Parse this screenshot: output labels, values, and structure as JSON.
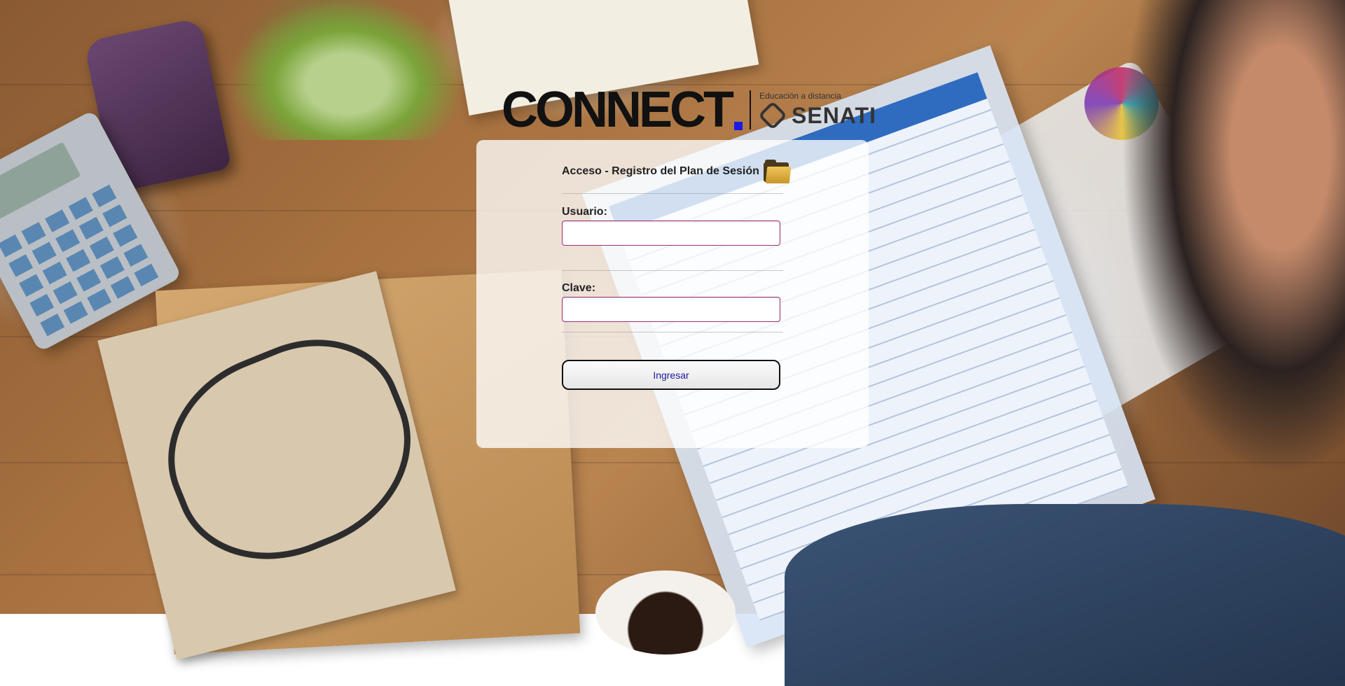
{
  "logo": {
    "brand": "CONNECT",
    "tagline": "Educación a distancia",
    "partner": "SENATI"
  },
  "login": {
    "title": "Acceso - Registro del Plan de Sesión",
    "title_icon": "folder-icon",
    "username_label": "Usuario:",
    "username_value": "",
    "password_label": "Clave:",
    "password_value": "",
    "submit_label": "Ingresar"
  },
  "colors": {
    "brand_dot": "#1a1ae6",
    "input_border": "#a0307a",
    "button_text": "#1a1aa0"
  }
}
